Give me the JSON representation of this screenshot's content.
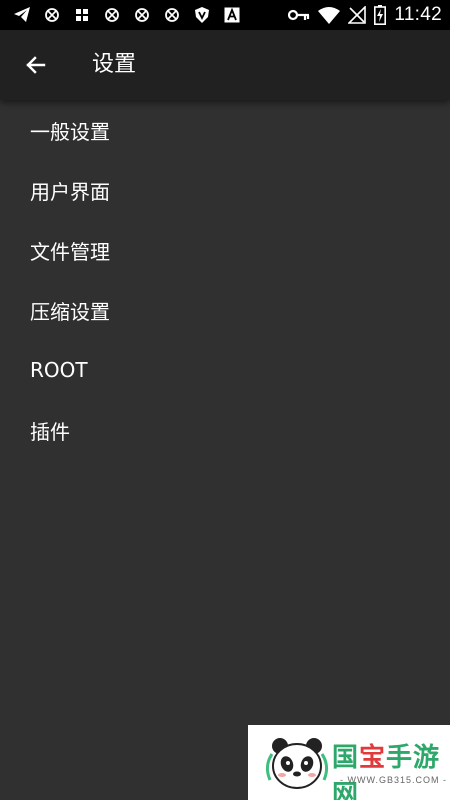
{
  "status_bar": {
    "time": "11:42",
    "left_icons": [
      "telegram-icon",
      "blocked-notification-icon",
      "grid-app-icon",
      "blocked-notification-icon",
      "blocked-notification-icon",
      "blocked-notification-icon",
      "shield-v-icon",
      "a-app-icon"
    ],
    "right_icons": [
      "key-icon",
      "wifi-icon",
      "no-sim-icon",
      "battery-charging-icon"
    ]
  },
  "app_bar": {
    "title": "设置"
  },
  "settings": {
    "items": [
      {
        "label": "一般设置"
      },
      {
        "label": "用户界面"
      },
      {
        "label": "文件管理"
      },
      {
        "label": "压缩设置"
      },
      {
        "label": "ROOT"
      },
      {
        "label": "插件"
      }
    ]
  },
  "watermark": {
    "brand": "国宝手游网",
    "brand_part1": "国",
    "brand_part2": "宝",
    "brand_part3": "手游网",
    "url": "- WWW.GB315.COM -"
  },
  "colors": {
    "background": "#303030",
    "app_bar": "#212121",
    "status_bar": "#000000",
    "text": "#ffffff"
  }
}
